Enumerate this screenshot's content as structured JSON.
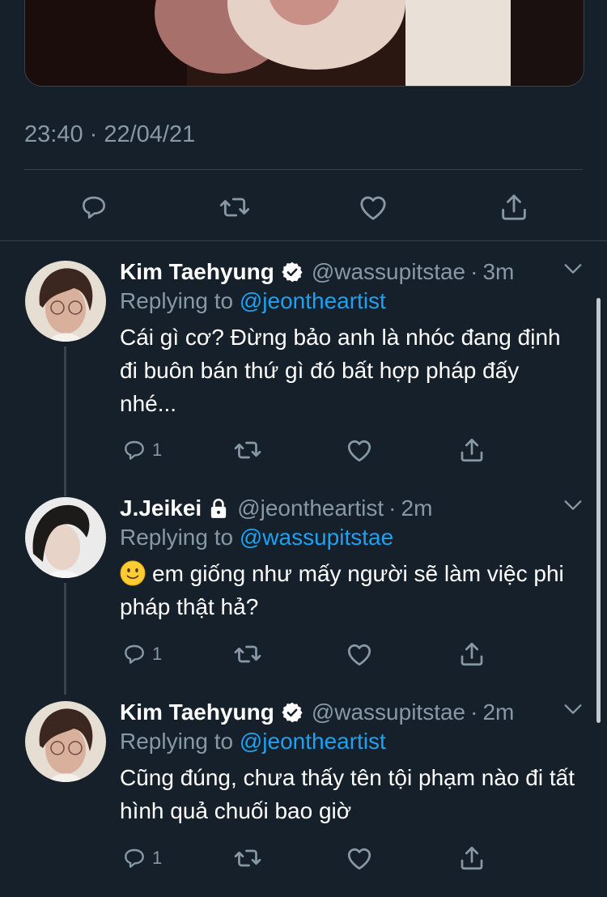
{
  "tweet": {
    "timestamp": "23:40 · 22/04/21",
    "actions": [
      "reply-icon",
      "retweet-icon",
      "like-icon",
      "share-icon"
    ]
  },
  "colors": {
    "background": "#15202b",
    "divider": "#38444d",
    "secondary_text": "#8899a6",
    "link": "#1da1f2"
  },
  "replies": [
    {
      "name": "Kim Taehyung",
      "badge": "verified-icon",
      "handle": "@wassupitstae",
      "separator": "·",
      "time": "3m",
      "replying_prefix": "Replying to",
      "replying_to": "@jeontheartist",
      "text": "Cái gì cơ? Đừng bảo anh là nhóc đang định đi buôn bán thứ gì đó bất hợp pháp đấy nhé...",
      "reply_count": "1"
    },
    {
      "name": "J.Jeikei",
      "badge": "lock-icon",
      "handle": "@jeontheartist",
      "separator": "·",
      "time": "2m",
      "replying_prefix": "Replying to",
      "replying_to": "@wassupitstae",
      "emoji": "slightly-smiling-face",
      "text": "em giống như mấy người sẽ làm việc phi pháp thật hả?",
      "reply_count": "1"
    },
    {
      "name": "Kim Taehyung",
      "badge": "verified-icon",
      "handle": "@wassupitstae",
      "separator": "·",
      "time": "2m",
      "replying_prefix": "Replying to",
      "replying_to": "@jeontheartist",
      "text": "Cũng đúng, chưa thấy tên tội phạm nào đi tất hình quả chuối bao giờ",
      "reply_count": "1"
    }
  ]
}
